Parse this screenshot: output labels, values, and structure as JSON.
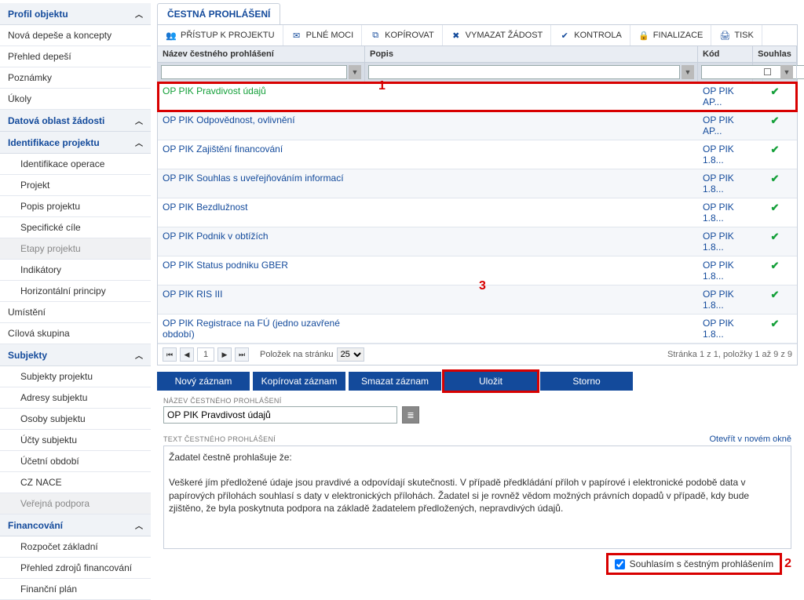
{
  "sidebar": {
    "sections": [
      {
        "title": "Profil objektu",
        "items": [
          "Nová depeše a koncepty",
          "Přehled depeší",
          "Poznámky",
          "Úkoly"
        ]
      },
      {
        "title": "Datová oblast žádosti",
        "items": []
      },
      {
        "title": "Identifikace projektu",
        "items": [
          "Identifikace operace",
          "Projekt",
          "Popis projektu",
          "Specifické cíle",
          "Etapy projektu",
          "Indikátory",
          "Horizontální principy"
        ],
        "disabledIdx": 4
      },
      "Umístění",
      "Cílová skupina",
      {
        "title": "Subjekty",
        "items": [
          "Subjekty projektu",
          "Adresy subjektu",
          "Osoby subjektu",
          "Účty subjektu",
          "Účetní období",
          "CZ NACE",
          "Veřejná podpora"
        ],
        "disabledIdx": 6
      },
      {
        "title": "Financování",
        "items": [
          "Rozpočet základní",
          "Přehled zdrojů financování",
          "Finanční plán"
        ]
      }
    ]
  },
  "tab": {
    "label": "ČESTNÁ PROHLÁŠENÍ"
  },
  "toolbar": {
    "items": [
      {
        "label": "PŘÍSTUP K PROJEKTU",
        "icon": "people-icon"
      },
      {
        "label": "PLNÉ MOCI",
        "icon": "envelope-icon"
      },
      {
        "label": "KOPÍROVAT",
        "icon": "copy-icon"
      },
      {
        "label": "VYMAZAT ŽÁDOST",
        "icon": "delete-icon"
      },
      {
        "label": "KONTROLA",
        "icon": "check-icon"
      },
      {
        "label": "FINALIZACE",
        "icon": "lock-icon"
      },
      {
        "label": "TISK",
        "icon": "print-icon"
      }
    ]
  },
  "table": {
    "headers": {
      "name": "Název čestného prohlášení",
      "desc": "Popis",
      "code": "Kód",
      "agree": "Souhlas"
    },
    "rows": [
      {
        "name": "OP PIK Pravdivost údajů",
        "desc": "",
        "code": "OP PIK AP...",
        "agree": true,
        "highlight": true
      },
      {
        "name": "OP PIK Odpovědnost, ovlivnění",
        "desc": "",
        "code": "OP PIK AP...",
        "agree": true
      },
      {
        "name": "OP PIK Zajištění financování",
        "desc": "",
        "code": "OP PIK 1.8...",
        "agree": true
      },
      {
        "name": "OP PIK Souhlas s uveřejňováním informací",
        "desc": "",
        "code": "OP PIK 1.8...",
        "agree": true
      },
      {
        "name": "OP PIK Bezdlužnost",
        "desc": "",
        "code": "OP PIK 1.8...",
        "agree": true
      },
      {
        "name": "OP PIK Podnik v obtížích",
        "desc": "",
        "code": "OP PIK 1.8...",
        "agree": true
      },
      {
        "name": "OP PIK Status podniku GBER",
        "desc": "",
        "code": "OP PIK 1.8...",
        "agree": true
      },
      {
        "name": "OP PIK RIS III",
        "desc": "",
        "code": "OP PIK 1.8...",
        "agree": true
      },
      {
        "name": "OP PIK Registrace na FÚ (jedno uzavřené období)",
        "desc": "",
        "code": "OP PIK 1.8...",
        "agree": true
      }
    ]
  },
  "pager": {
    "itemsPerPageLabel": "Položek na stránku",
    "itemsPerPage": "25",
    "page": "1",
    "summary": "Stránka 1 z 1, položky 1 až 9 z 9"
  },
  "actions": {
    "new": "Nový záznam",
    "copy": "Kopírovat záznam",
    "delete": "Smazat záznam",
    "save": "Uložit",
    "cancel": "Storno"
  },
  "detail": {
    "nameLabel": "NÁZEV ČESTNÉHO PROHLÁŠENÍ",
    "nameValue": "OP PIK Pravdivost údajů",
    "textLabel": "TEXT ČESTNÉHO PROHLÁŠENÍ",
    "openLink": "Otevřít v novém okně",
    "textBody": "Žadatel čestně prohlašuje že:\n\nVeškeré jím předložené údaje jsou pravdivé a odpovídají skutečnosti. V případě předkládání příloh v papírové i elektronické podobě data v papírových přílohách souhlasí s daty v elektronických přílohách. Žadatel si je rovněž vědom možných právních dopadů v případě, kdy bude zjištěno, že byla poskytnuta podpora na základě žadatelem předložených, nepravdivých údajů.",
    "agreeLabel": "Souhlasím s čestným prohlášením",
    "agreeChecked": true
  },
  "annotations": {
    "a1": "1",
    "a2": "2",
    "a3": "3"
  }
}
